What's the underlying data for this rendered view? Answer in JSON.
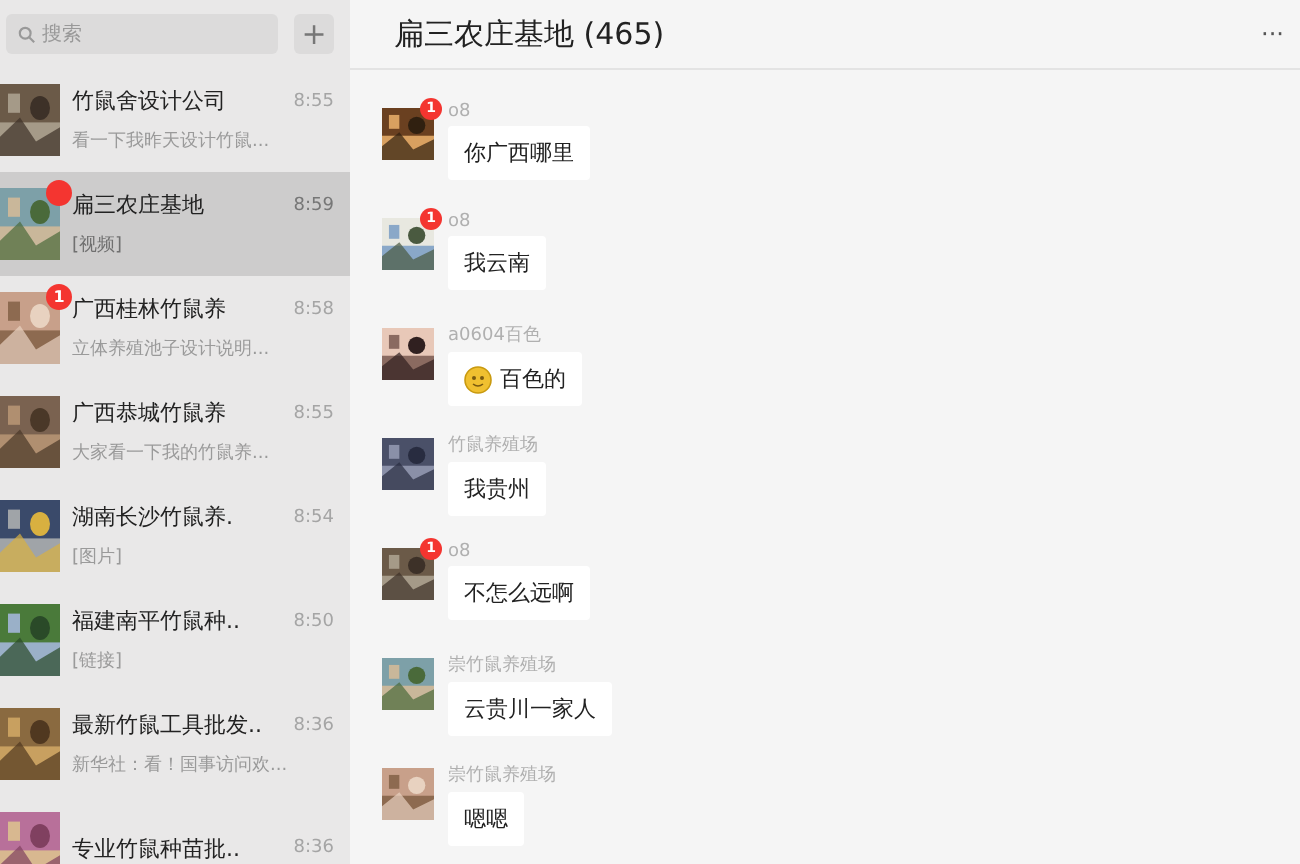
{
  "search": {
    "placeholder": "搜索",
    "add_button": "+"
  },
  "chats": [
    {
      "name": "竹鼠舍设计公司",
      "time": "8:55",
      "preview": "看一下我昨天设计竹鼠...",
      "selected": false
    },
    {
      "name": "扁三农庄基地",
      "time": "8:59",
      "preview": "[视频]",
      "selected": true,
      "badge": {
        "kind": "dot"
      }
    },
    {
      "name": "广西桂林竹鼠养",
      "time": "8:58",
      "preview": "立体养殖池子设计说明...",
      "selected": false,
      "badge": {
        "kind": "count",
        "text": "1"
      }
    },
    {
      "name": "广西恭城竹鼠养",
      "time": "8:55",
      "preview": "大家看一下我的竹鼠养...",
      "selected": false
    },
    {
      "name": "湖南长沙竹鼠养.",
      "time": "8:54",
      "preview": "[图片]",
      "selected": false
    },
    {
      "name": "福建南平竹鼠种..",
      "time": "8:50",
      "preview": "[链接]",
      "selected": false
    },
    {
      "name": "最新竹鼠工具批发..",
      "time": "8:36",
      "preview": "新华社：看！国事访问欢...",
      "selected": false
    },
    {
      "name": "专业竹鼠种苗批..",
      "time": "8:36",
      "selected": false
    }
  ],
  "conversation": {
    "title": "扁三农庄基地 (465)",
    "more_button": "···",
    "messages": [
      {
        "sender": "o8",
        "text": "你广西哪里",
        "avatar_badge": "1"
      },
      {
        "sender": "o8",
        "text": "我云南",
        "avatar_badge": "1"
      },
      {
        "sender": "a0604百色",
        "text": "百色的",
        "emoji": true
      },
      {
        "sender": "竹鼠养殖场",
        "text": "我贵州"
      },
      {
        "sender": "o8",
        "text": "不怎么远啊",
        "avatar_badge": "1"
      },
      {
        "sender": "崇竹鼠养殖场",
        "text": "云贵川一家人"
      },
      {
        "sender": "崇竹鼠养殖场",
        "text": "嗯嗯"
      }
    ]
  }
}
